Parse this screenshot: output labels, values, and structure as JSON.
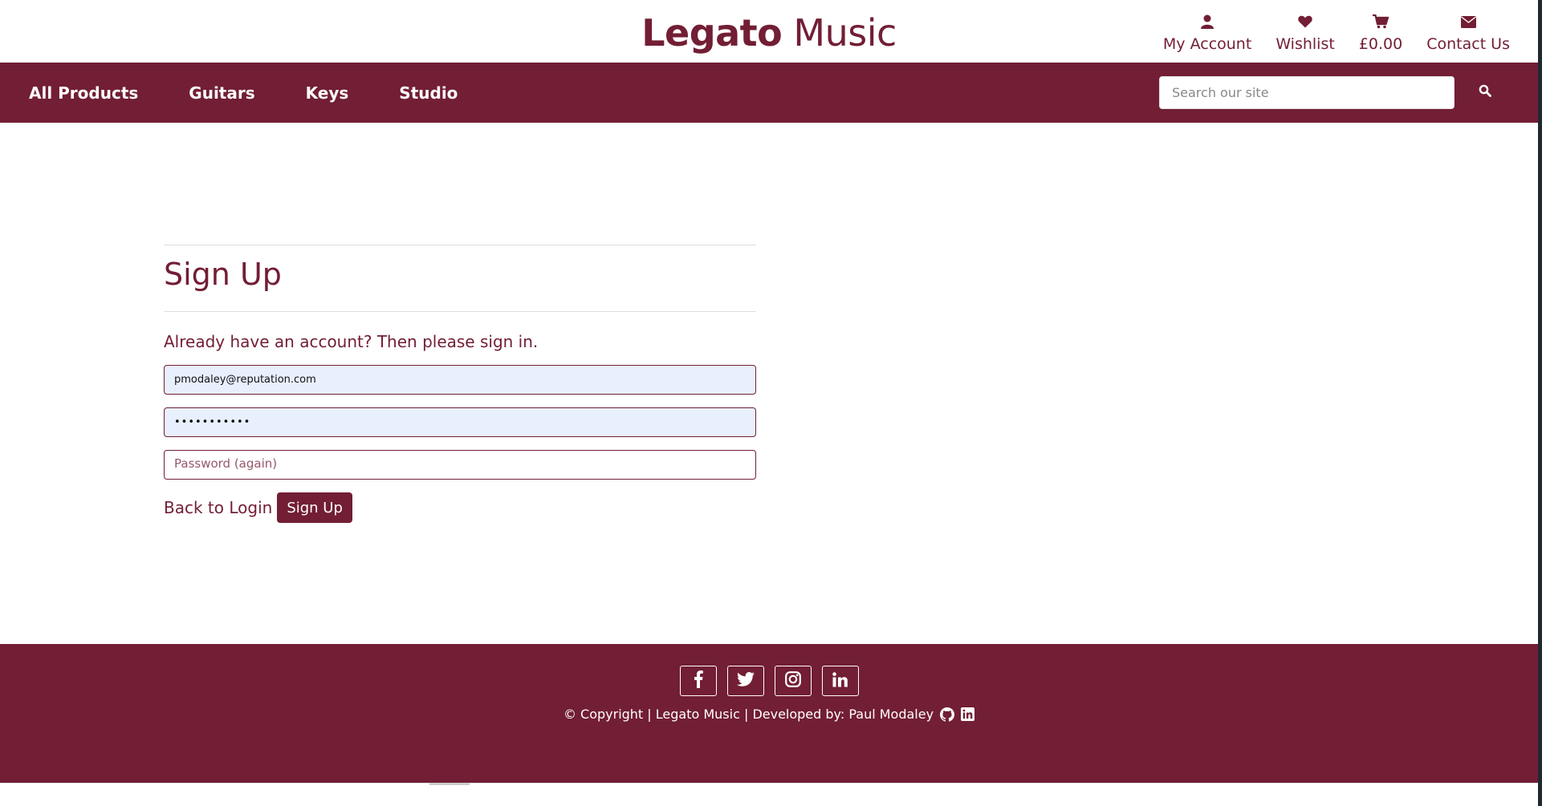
{
  "brand": {
    "part1": "Legato",
    "part2": "Music"
  },
  "account_links": [
    {
      "icon": "user-icon",
      "label": "My Account"
    },
    {
      "icon": "heart-icon",
      "label": "Wishlist"
    },
    {
      "icon": "cart-icon",
      "label": "£0.00"
    },
    {
      "icon": "envelope-icon",
      "label": "Contact Us"
    }
  ],
  "nav": {
    "items": [
      "All Products",
      "Guitars",
      "Keys",
      "Studio"
    ],
    "search_placeholder": "Search our site",
    "search_icon": "search-icon"
  },
  "signup": {
    "title": "Sign Up",
    "intro": "Already have an account? Then please sign in.",
    "email_value": "pmodaley@reputation.com",
    "password_value": "•••••••••••",
    "password_again_placeholder": "Password (again)",
    "back_label": "Back to Login",
    "submit_label": "Sign Up"
  },
  "footer": {
    "socials": [
      "facebook-icon",
      "twitter-icon",
      "instagram-icon",
      "linkedin-icon"
    ],
    "copyright": "© Copyright | Legato Music | Developed by: Paul Modaley"
  },
  "colors": {
    "brand": "#721e34",
    "white": "#ffffff",
    "autofill": "#e8f0fe"
  }
}
